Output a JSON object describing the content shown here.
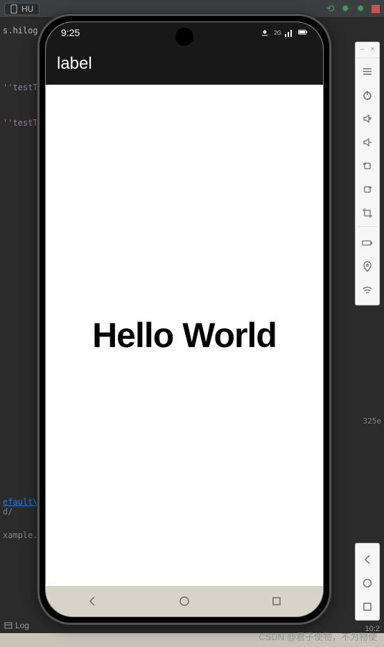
{
  "ide": {
    "device_label": "HU",
    "left_code": {
      "line1": "s.hilog",
      "tag1": "'testTa",
      "tag2": "'testTa"
    },
    "bottom_code": {
      "link": "efault\\",
      "line2": "d/",
      "line3": "xample."
    },
    "right_snippet": "325e",
    "status_left_icon": "Log",
    "status_right": "10:2"
  },
  "emulator_toolbar": {
    "minimize": "–",
    "close": "×",
    "buttons": [
      "menu",
      "power",
      "volume-up",
      "volume-down",
      "rotate-left",
      "rotate-right",
      "crop",
      "battery",
      "location",
      "wifi"
    ],
    "nav_buttons": [
      "back",
      "home",
      "recent"
    ]
  },
  "phone": {
    "status": {
      "time": "9:25",
      "signal_label": "2G"
    },
    "app_title": "label",
    "content_text": "Hello World"
  },
  "watermark": "CSDN @君子使物，不为物使"
}
